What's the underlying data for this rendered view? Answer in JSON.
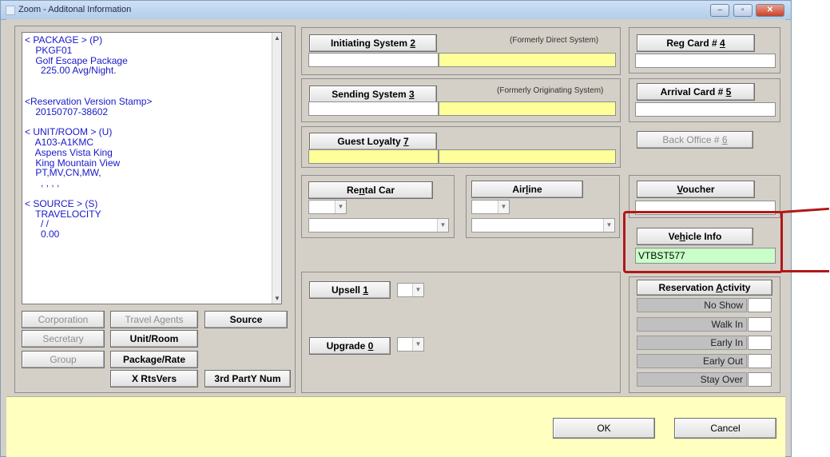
{
  "window": {
    "title": "Zoom - Additonal Information",
    "minimize": "–",
    "maximize": "▫",
    "close": "✕"
  },
  "info_text": "< PACKAGE > (P)\n    PKGF01\n    Golf Escape Package\n      225.00 Avg/Night.\n\n\n<Reservation Version Stamp>\n    20150707-38602\n\n< UNIT/ROOM > (U)\n    A103-A1KMC\n    Aspens Vista King\n    King Mountain View\n    PT,MV,CN,MW,\n      , , , ,\n\n< SOURCE > (S)\n    TRAVELOCITY\n      / /\n      0.00",
  "left_buttons": {
    "corporation": "Corporation",
    "travel_agents": "Travel Agents",
    "source": "Source",
    "secretary": "Secretary",
    "unit_room": "Unit/Room",
    "group": "Group",
    "package_rate": "Package/Rate",
    "x_rts_vers": "X RtsVers",
    "third_party": "3rd PartY Num"
  },
  "initiating": {
    "label_pre": "Initiating System ",
    "label_key": "2",
    "note": "(Formerly Direct System)"
  },
  "sending": {
    "label_pre": "Sending System ",
    "label_key": "3",
    "note": "(Formerly Originating System)"
  },
  "loyalty": {
    "label_pre": "Guest Loyalty ",
    "label_key": "7"
  },
  "rental_car": {
    "label_pre": "Re",
    "label_key": "n",
    "label_post": "tal Car"
  },
  "airline": {
    "label_pre": "Air",
    "label_key": "l",
    "label_post": "ine"
  },
  "upsell": {
    "label_pre": "Upsell ",
    "label_key": "1"
  },
  "upgrade": {
    "label_pre": "Upgrade ",
    "label_key": "0"
  },
  "reg_card": {
    "label_pre": "Reg Card # ",
    "label_key": "4"
  },
  "arrival_card": {
    "label_pre": "Arrival Card # ",
    "label_key": "5"
  },
  "back_office": {
    "label_pre": "Back Office # ",
    "label_key": "6"
  },
  "voucher": {
    "label_key": "V",
    "label_post": "oucher"
  },
  "vehicle": {
    "label_pre": "Ve",
    "label_key": "h",
    "label_post": "icle Info",
    "value": "VTBST577"
  },
  "reservation_activity": {
    "label_pre": "Reservation ",
    "label_key": "A",
    "label_post": "ctivity",
    "rows": [
      "No Show",
      "Walk In",
      "Early In",
      "Early Out",
      "Stay Over"
    ]
  },
  "footer": {
    "ok": "OK",
    "cancel": "Cancel"
  },
  "colors": {
    "highlight": "#b01818",
    "footer_bg": "#ffffc0",
    "field_yellow": "#ffff99",
    "field_green": "#c8ffc8"
  }
}
